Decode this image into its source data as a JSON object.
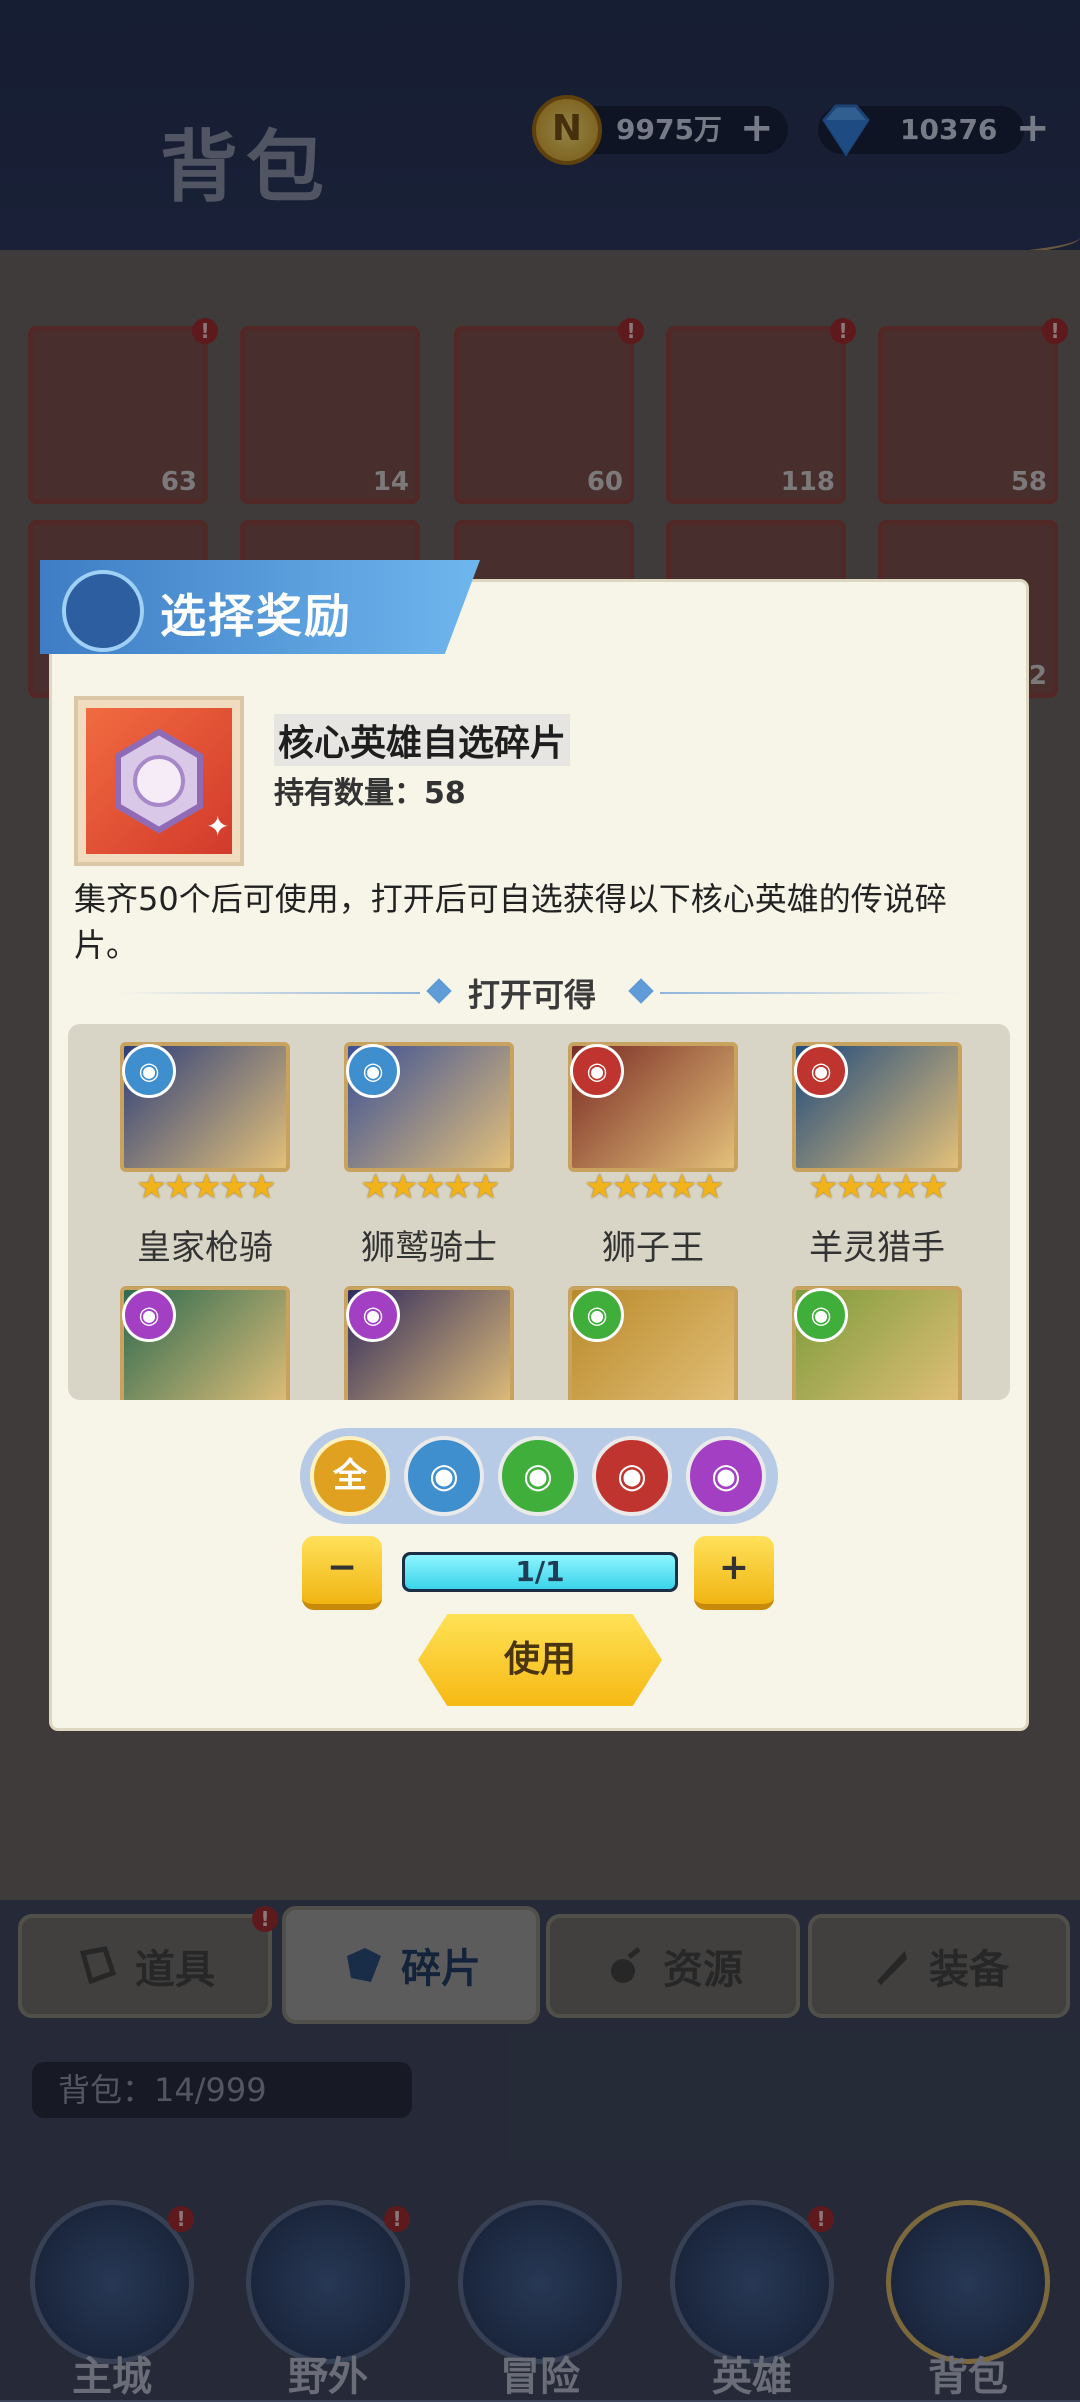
{
  "header": {
    "title": "背包",
    "gold": "9975万",
    "gems": "10376"
  },
  "bag_items": [
    {
      "count": "63",
      "alert": true
    },
    {
      "count": "14",
      "alert": false
    },
    {
      "count": "60",
      "alert": true
    },
    {
      "count": "118",
      "alert": true
    },
    {
      "count": "58",
      "alert": true
    },
    {
      "count": "",
      "alert": false
    },
    {
      "count": "",
      "alert": false
    },
    {
      "count": "",
      "alert": false
    },
    {
      "count": "",
      "alert": false
    },
    {
      "count": "2",
      "alert": false
    }
  ],
  "modal": {
    "title": "选择奖励",
    "item_name": "核心英雄自选碎片",
    "owned_label": "持有数量：58",
    "description": "集齐50个后可使用，打开后可自选获得以下核心英雄的传说碎片。",
    "section_title": "打开可得",
    "heroes": [
      {
        "name": "皇家枪骑",
        "stars": "★★★★★",
        "faction": "armor"
      },
      {
        "name": "狮鹫骑士",
        "stars": "★★★★★",
        "faction": "armor"
      },
      {
        "name": "狮子王",
        "stars": "★★★★★",
        "faction": "demon"
      },
      {
        "name": "羊灵猎手",
        "stars": "★★★★★",
        "faction": "demon"
      },
      {
        "name": "",
        "stars": "",
        "faction": "shadow"
      },
      {
        "name": "",
        "stars": "",
        "faction": "shadow"
      },
      {
        "name": "",
        "stars": "",
        "faction": "nature"
      },
      {
        "name": "",
        "stars": "",
        "faction": "nature"
      }
    ],
    "filters": [
      "全",
      "armor",
      "nature",
      "demon",
      "shadow"
    ],
    "minus": "−",
    "plus": "+",
    "progress_text": "1/1",
    "progress_fraction": 1.0,
    "use_button": "使用"
  },
  "tabs": [
    {
      "label": "道具",
      "alert": true
    },
    {
      "label": "碎片",
      "active": true
    },
    {
      "label": "资源"
    },
    {
      "label": "装备"
    }
  ],
  "bag_count": "背包：14/999",
  "bottom_nav": [
    {
      "label": "主城",
      "alert": true
    },
    {
      "label": "野外",
      "alert": true
    },
    {
      "label": "冒险",
      "alert": false
    },
    {
      "label": "英雄",
      "alert": true
    },
    {
      "label": "背包",
      "alert": false
    }
  ],
  "colors": {
    "armor": "#3f8fcf",
    "nature": "#3fae3a",
    "demon": "#c0342f",
    "shadow": "#a33fc2",
    "all": "#e0a020",
    "accent_blue": "#3e7dc4"
  }
}
